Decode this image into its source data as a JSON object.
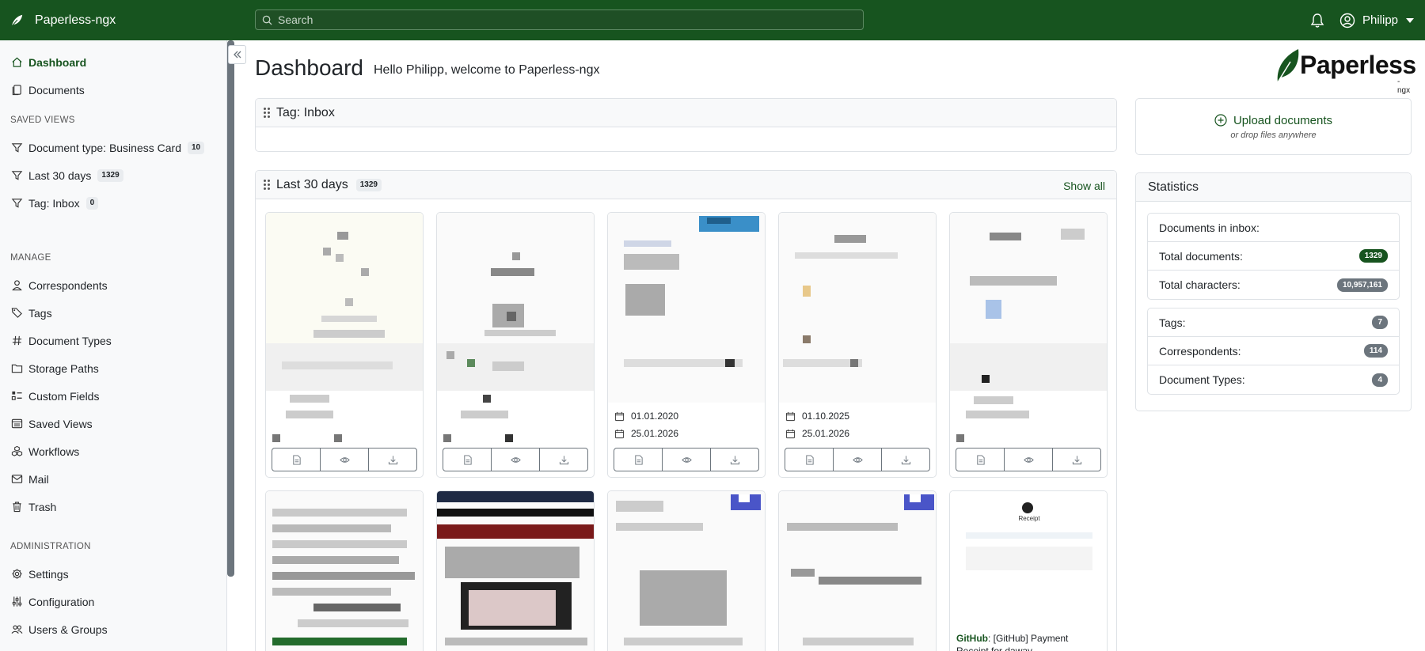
{
  "app": {
    "name": "Paperless-ngx"
  },
  "search": {
    "placeholder": "Search"
  },
  "user": {
    "name": "Philipp"
  },
  "sidebar": {
    "dashboard": "Dashboard",
    "documents": "Documents",
    "saved_views_heading": "SAVED VIEWS",
    "saved_views": [
      {
        "label": "Document type: Business Card",
        "count": "10"
      },
      {
        "label": "Last 30 days",
        "count": "1329"
      },
      {
        "label": "Tag: Inbox",
        "count": "0"
      }
    ],
    "manage_heading": "MANAGE",
    "manage": [
      "Correspondents",
      "Tags",
      "Document Types",
      "Storage Paths",
      "Custom Fields",
      "Saved Views",
      "Workflows",
      "Mail",
      "Trash"
    ],
    "admin_heading": "ADMINISTRATION",
    "admin": [
      "Settings",
      "Configuration",
      "Users & Groups"
    ]
  },
  "main": {
    "title": "Dashboard",
    "welcome": "Hello Philipp, welcome to Paperless-ngx",
    "logo_text": "Paperless",
    "logo_sub": "-ngx",
    "inbox_widget": {
      "title": "Tag: Inbox"
    },
    "recent_widget": {
      "title": "Last 30 days",
      "count": "1329",
      "show_all": "Show all"
    },
    "docs_row1": [
      {
        "dates": []
      },
      {
        "dates": []
      },
      {
        "dates": [
          "01.01.2020",
          "25.01.2026"
        ]
      },
      {
        "dates": [
          "01.10.2025",
          "25.01.2026"
        ]
      },
      {
        "dates": []
      }
    ],
    "doc_row2_last": {
      "thumb_label": "Receipt",
      "caption_bold": "GitHub",
      "caption": ": [GitHub] Payment Receipt for daway"
    }
  },
  "upload": {
    "label": "Upload documents",
    "sub": "or drop files anywhere"
  },
  "statistics": {
    "title": "Statistics",
    "group1": [
      {
        "label": "Documents in inbox:",
        "value": ""
      },
      {
        "label": "Total documents:",
        "value": "1329"
      },
      {
        "label": "Total characters:",
        "value": "10,957,161"
      }
    ],
    "group2": [
      {
        "label": "Tags:",
        "value": "7"
      },
      {
        "label": "Correspondents:",
        "value": "114"
      },
      {
        "label": "Document Types:",
        "value": "4"
      }
    ]
  },
  "colors": {
    "brand": "#17541f",
    "badge_grey": "#6c757d"
  }
}
